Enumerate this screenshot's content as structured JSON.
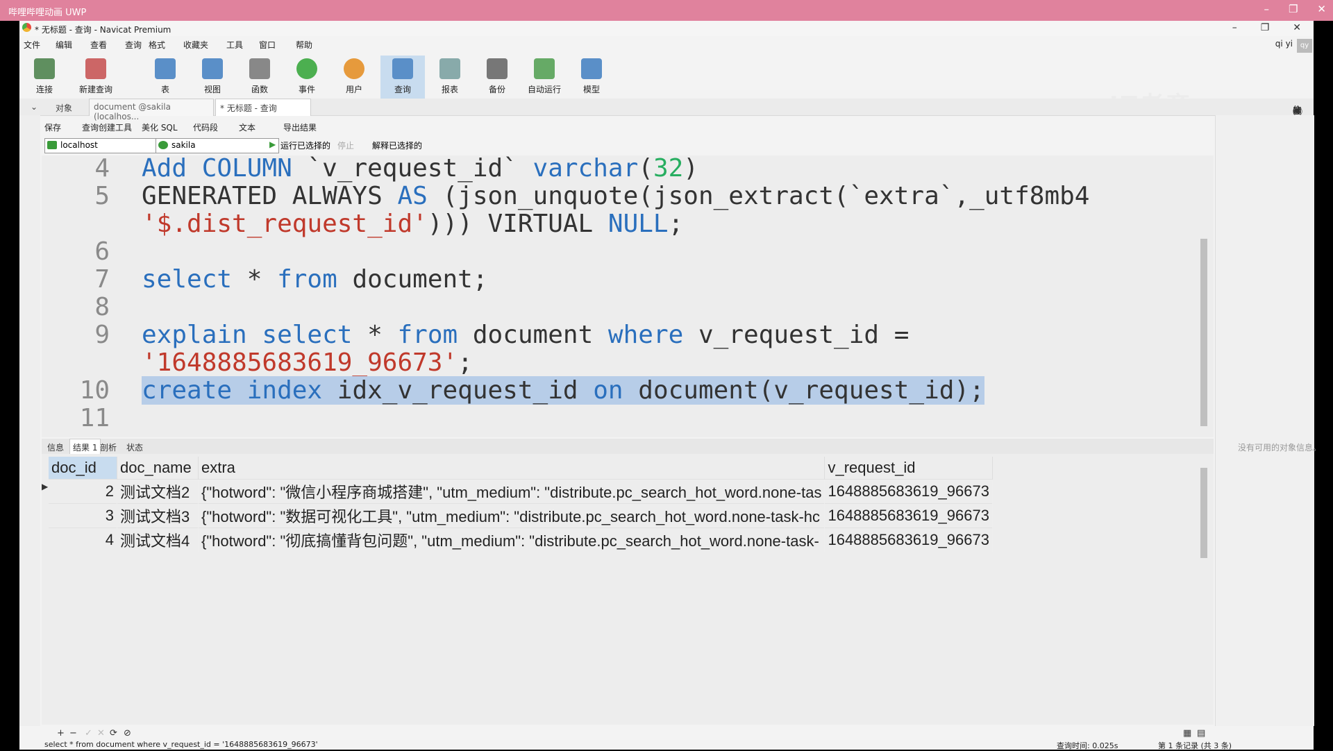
{
  "uwp": {
    "title": "哔哩哔哩动画 UWP"
  },
  "app": {
    "title": "* 无标题 - 查询 - Navicat Premium"
  },
  "menu": [
    "文件",
    "编辑",
    "查看",
    "查询",
    "格式",
    "收藏夹",
    "工具",
    "窗口",
    "帮助"
  ],
  "user": {
    "name": "qi yi",
    "avatar": "qy"
  },
  "toolbar": [
    "连接",
    "新建查询",
    "表",
    "视图",
    "函数",
    "事件",
    "用户",
    "查询",
    "报表",
    "备份",
    "自动运行",
    "模型"
  ],
  "watermark": "IT老齐",
  "tabs": {
    "objects": "对象",
    "doc_tab": "document @sakila (localhos...",
    "query_tab": "* 无标题 - 查询"
  },
  "query_toolbar": {
    "save": "保存",
    "builder": "查询创建工具",
    "beautify": "美化 SQL",
    "snippet": "代码段",
    "text": "文本",
    "export": "导出结果"
  },
  "connection": {
    "server": "localhost",
    "database": "sakila",
    "run_selected": "运行已选择的",
    "stop": "停止",
    "explain_selected": "解释已选择的"
  },
  "editor": {
    "lines": [
      {
        "num": "4",
        "text": "Add COLUMN `v_request_id` varchar(32)"
      },
      {
        "num": "5",
        "text": "GENERATED ALWAYS AS (json_unquote(json_extract(`extra`,_utf8mb4"
      },
      {
        "num": "",
        "text": "'$.dist_request_id'))) VIRTUAL NULL;"
      },
      {
        "num": "6",
        "text": ""
      },
      {
        "num": "7",
        "text": "select * from document;"
      },
      {
        "num": "8",
        "text": ""
      },
      {
        "num": "9",
        "text": "explain select * from document where v_request_id ="
      },
      {
        "num": "",
        "text": "'1648885683619_96673';"
      },
      {
        "num": "10",
        "text": "create index idx_v_request_id on document(v_request_id);"
      },
      {
        "num": "11",
        "text": ""
      }
    ]
  },
  "result_tabs": [
    "信息",
    "结果 1",
    "剖析",
    "状态"
  ],
  "results": {
    "columns": [
      "doc_id",
      "doc_name",
      "extra",
      "v_request_id"
    ],
    "rows": [
      [
        "2",
        "测试文档2",
        "{\"hotword\": \"微信小程序商城搭建\", \"utm_medium\": \"distribute.pc_search_hot_word.none-tas",
        "1648885683619_96673"
      ],
      [
        "3",
        "测试文档3",
        "{\"hotword\": \"数据可视化工具\", \"utm_medium\": \"distribute.pc_search_hot_word.none-task-hc",
        "1648885683619_96673"
      ],
      [
        "4",
        "测试文档4",
        "{\"hotword\": \"彻底搞懂背包问题\", \"utm_medium\": \"distribute.pc_search_hot_word.none-task-",
        "1648885683619_96673"
      ]
    ]
  },
  "right_panel": {
    "empty_msg": "没有可用的对象信息。"
  },
  "status": {
    "sql": "select * from document where v_request_id = '1648885683619_96673'",
    "query_time": "查询时间: 0.025s",
    "records": "第 1 条记录 (共 3 条)"
  }
}
